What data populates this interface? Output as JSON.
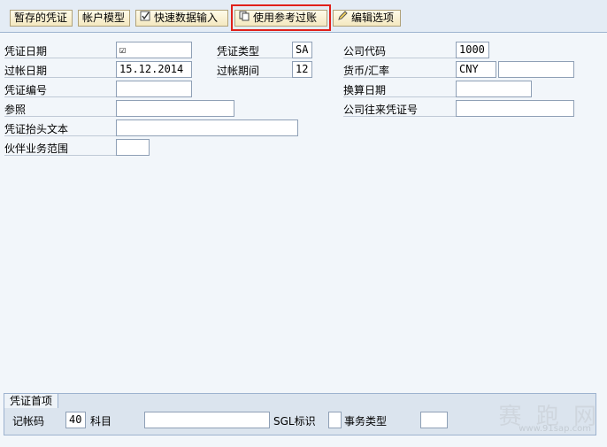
{
  "toolbar": {
    "park_doc": "暂存的凭证",
    "account_model": "帐户模型",
    "fast_entry": "快速数据输入",
    "post_with_ref": "使用参考过账",
    "edit_options": "编辑选项"
  },
  "header": {
    "doc_date_label": "凭证日期",
    "doc_date_value": "☑",
    "posting_date_label": "过帐日期",
    "posting_date_value": "15.12.2014",
    "doc_number_label": "凭证编号",
    "doc_number_value": "",
    "reference_label": "参照",
    "reference_value": "",
    "header_text_label": "凭证抬头文本",
    "header_text_value": "",
    "trading_partner_label": "伙伴业务范围",
    "trading_partner_value": "",
    "doc_type_label": "凭证类型",
    "doc_type_value": "SA",
    "period_label": "过帐期间",
    "period_value": "12",
    "company_code_label": "公司代码",
    "company_code_value": "1000",
    "currency_label": "货币/汇率",
    "currency_value": "CNY",
    "rate_value": "",
    "translation_date_label": "换算日期",
    "translation_date_value": "",
    "cross_cc_label": "公司往来凭证号",
    "cross_cc_value": ""
  },
  "line_item": {
    "tab_label": "凭证首项",
    "posting_key_label": "记帐码",
    "posting_key_value": "40",
    "account_label": "科目",
    "account_value": "",
    "sgl_label": "SGL标识",
    "sgl_value": "",
    "trans_type_label": "事务类型",
    "trans_type_value": ""
  },
  "watermark": {
    "text": "赛 跑 网",
    "url": "www.91sap.com"
  }
}
